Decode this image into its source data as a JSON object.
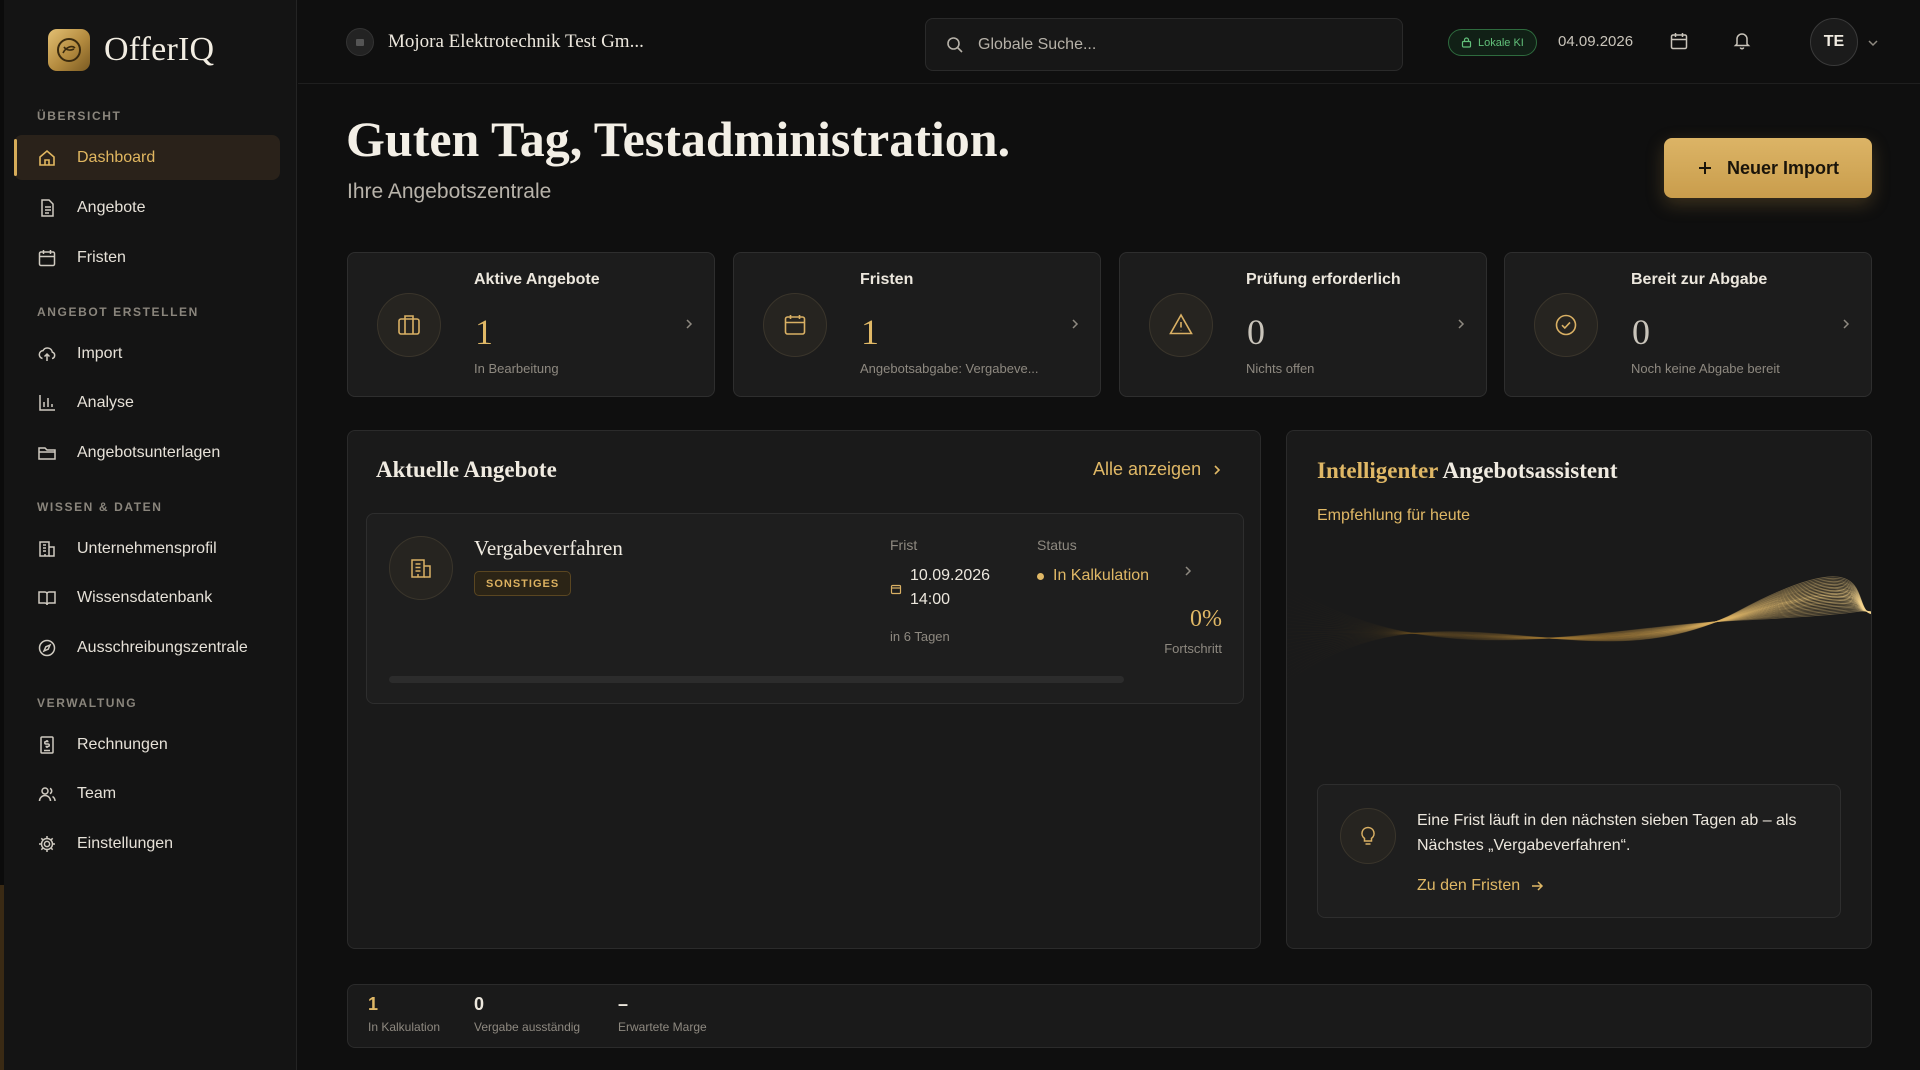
{
  "app": {
    "name": "OfferIQ"
  },
  "sidebar": {
    "sections": [
      {
        "title": "ÜBERSICHT"
      },
      {
        "title": "ANGEBOT ERSTELLEN"
      },
      {
        "title": "WISSEN & DATEN"
      },
      {
        "title": "VERWALTUNG"
      }
    ],
    "items": [
      {
        "label": "Dashboard",
        "icon": "home-icon",
        "active": true
      },
      {
        "label": "Angebote",
        "icon": "document-icon"
      },
      {
        "label": "Fristen",
        "icon": "calendar-icon"
      },
      {
        "label": "Import",
        "icon": "upload-cloud-icon"
      },
      {
        "label": "Analyse",
        "icon": "bar-chart-icon"
      },
      {
        "label": "Angebotsunterlagen",
        "icon": "folder-icon"
      },
      {
        "label": "Unternehmensprofil",
        "icon": "building-icon"
      },
      {
        "label": "Wissensdatenbank",
        "icon": "book-icon"
      },
      {
        "label": "Ausschreibungszentrale",
        "icon": "compass-icon"
      },
      {
        "label": "Rechnungen",
        "icon": "invoice-icon"
      },
      {
        "label": "Team",
        "icon": "users-icon"
      },
      {
        "label": "Einstellungen",
        "icon": "gear-icon"
      }
    ]
  },
  "topbar": {
    "organization": "Mojora Elektrotechnik Test Gm...",
    "search_placeholder": "Globale Suche...",
    "ki_badge": "Lokale KI",
    "date": "04.09.2026",
    "user_initials": "TE"
  },
  "header": {
    "greeting": "Guten Tag, Testadministration.",
    "subtitle": "Ihre Angebotszentrale",
    "new_import_label": "Neuer Import"
  },
  "stats": [
    {
      "title": "Aktive Angebote",
      "value": "1",
      "sub": "In Bearbeitung",
      "icon": "briefcase-icon"
    },
    {
      "title": "Fristen",
      "value": "1",
      "sub": "Angebotsabgabe: Vergabeve...",
      "icon": "calendar-icon"
    },
    {
      "title": "Prüfung erforderlich",
      "value": "0",
      "sub": "Nichts offen",
      "icon": "warning-icon"
    },
    {
      "title": "Bereit zur Abgabe",
      "value": "0",
      "sub": "Noch keine Abgabe bereit",
      "icon": "check-circle-icon"
    }
  ],
  "current_offers": {
    "title": "Aktuelle Angebote",
    "show_all_label": "Alle anzeigen",
    "offer": {
      "name": "Vergabeverfahren",
      "tag": "SONSTIGES",
      "deadline_label": "Frist",
      "deadline_date": "10.09.2026",
      "deadline_time": "14:00",
      "deadline_relative": "in 6 Tagen",
      "status_label": "Status",
      "status_value": "In Kalkulation",
      "progress_text": "0%",
      "progress_fraction": 0,
      "progress_label": "Fortschritt"
    }
  },
  "assistant": {
    "title_accent": "Intelligenter",
    "title_rest": "Angebotsassistent",
    "subtitle": "Empfehlung für heute",
    "tip_text": "Eine Frist läuft in den nächsten sieben Tagen ab – als Nächstes „Vergabeverfahren“.",
    "tip_link": "Zu den Fristen"
  },
  "footer_stats": [
    {
      "value": "1",
      "label": "In Kalkulation"
    },
    {
      "value": "0",
      "label": "Vergabe ausständig"
    },
    {
      "value": "–",
      "label": "Erwartete Marge"
    }
  ],
  "colors": {
    "accent": "#e0b866",
    "background": "#0f0f0f",
    "card": "#1c1c1c",
    "ki_green": "#62c07a"
  }
}
